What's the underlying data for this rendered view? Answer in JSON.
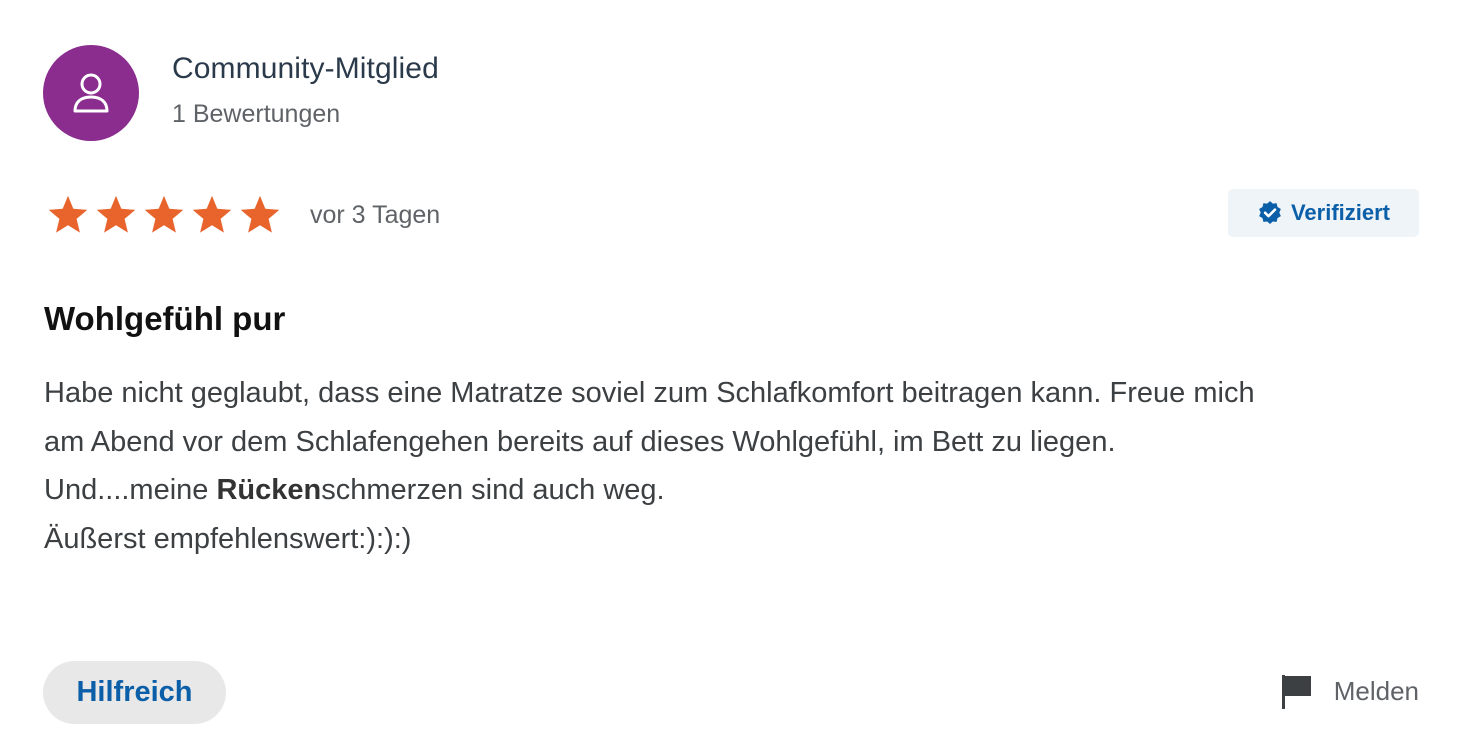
{
  "colors": {
    "avatar_bg": "#8a2d8e",
    "star": "#e8642c",
    "accent_blue": "#0b5ea8",
    "verified_bg": "#eef4f8"
  },
  "author": {
    "name": "Community-Mitglied",
    "review_count": "1 Bewertungen",
    "avatar_icon": "user-icon"
  },
  "rating": {
    "stars": 5,
    "max": 5,
    "date": "vor 3 Tagen"
  },
  "verified": {
    "label": "Verifiziert",
    "icon": "verified-badge-icon"
  },
  "review": {
    "title": "Wohlgefühl pur",
    "line1": "Habe nicht geglaubt, dass eine Matratze soviel zum Schlafkomfort beitragen kann. Freue mich",
    "line2": "am Abend vor dem Schlafengehen bereits auf dieses Wohlgefühl, im Bett zu liegen.",
    "line3_prefix": "Und....meine ",
    "line3_bold": "Rücken",
    "line3_suffix": "schmerzen sind auch weg.",
    "line4": "Äußerst empfehlenswert:):):)"
  },
  "actions": {
    "helpful_label": "Hilfreich",
    "report_label": "Melden",
    "report_icon": "flag-icon"
  }
}
